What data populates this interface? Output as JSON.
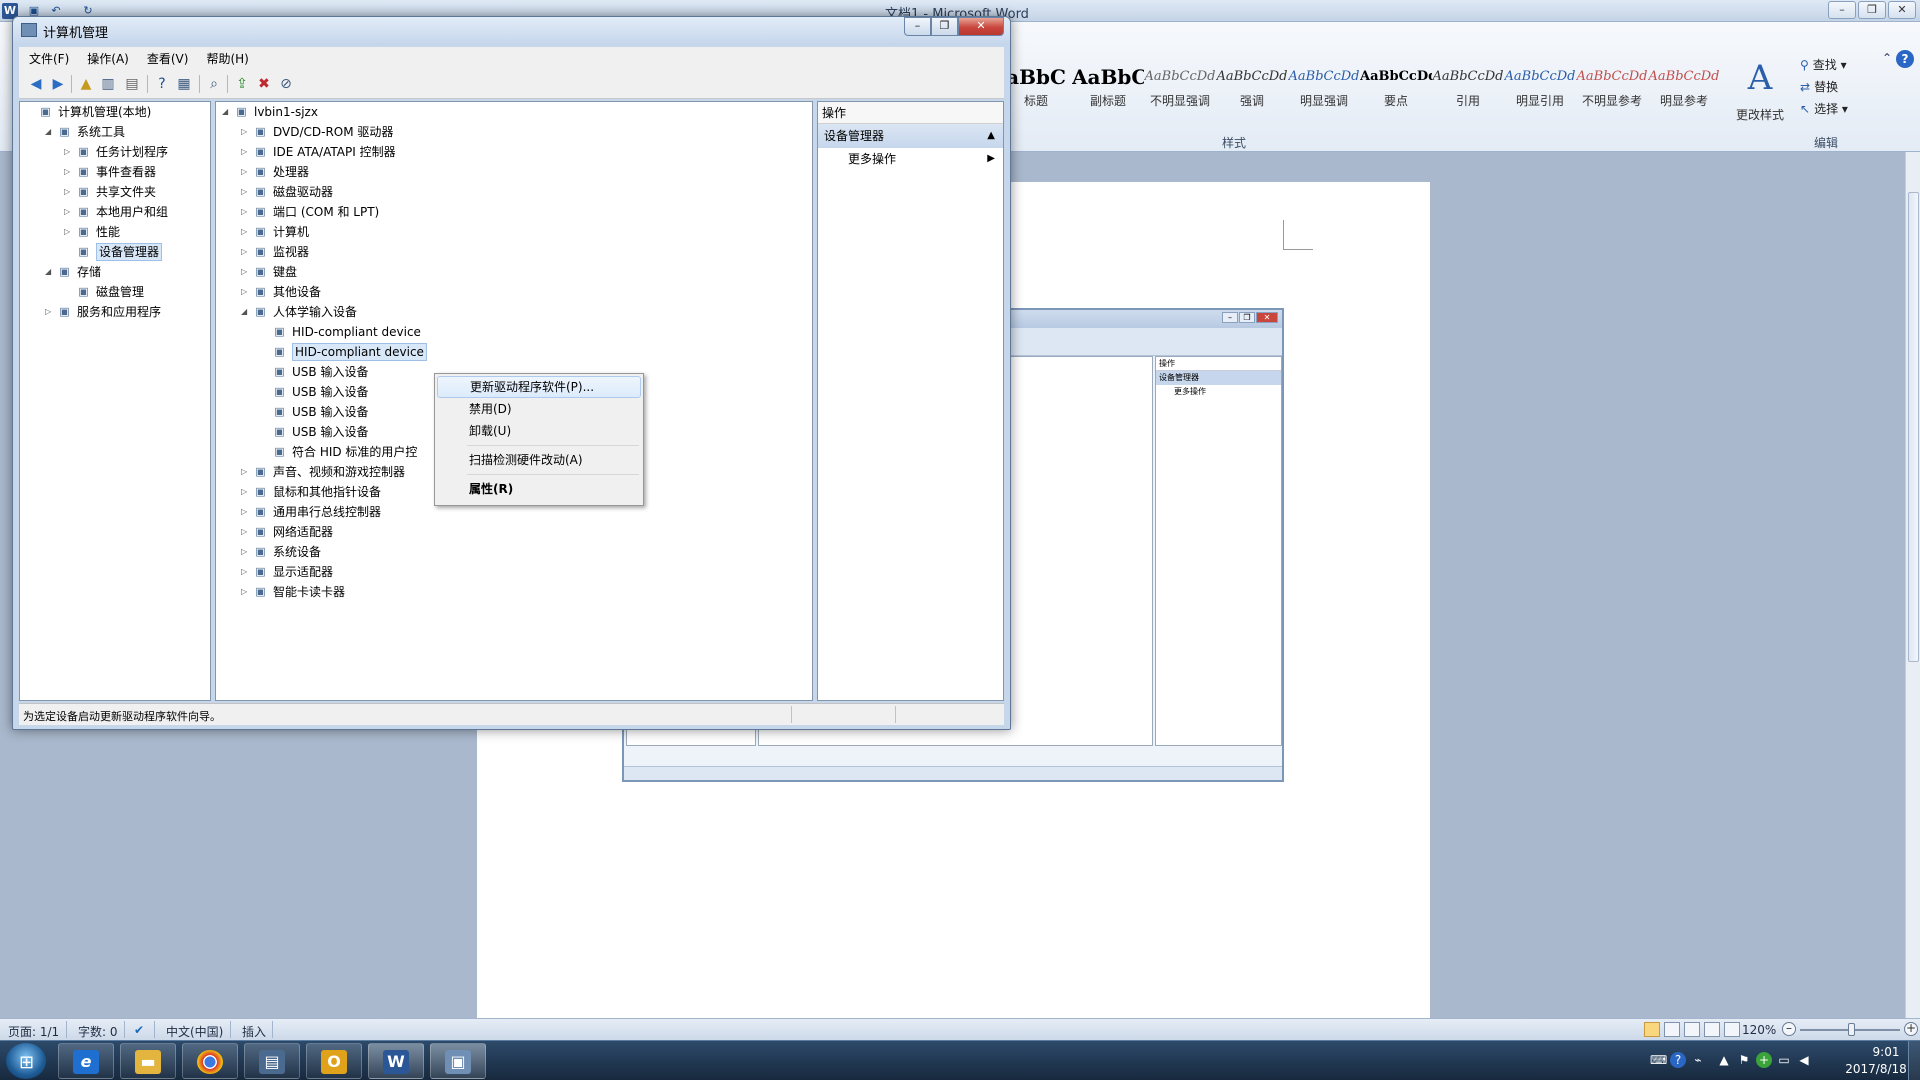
{
  "word": {
    "title": "文档1 - Microsoft Word",
    "styles": [
      {
        "sample": "aBbC",
        "label": "标题",
        "big": true
      },
      {
        "sample": "AaBbC",
        "label": "副标题",
        "big": true
      },
      {
        "sample": "AaBbCcDd",
        "label": "不明显强调"
      },
      {
        "sample": "AaBbCcDd",
        "label": "强调"
      },
      {
        "sample": "AaBbCcDd",
        "label": "明显强调"
      },
      {
        "sample": "AaBbCcDd",
        "label": "要点"
      },
      {
        "sample": "AaBbCcDd",
        "label": "引用"
      },
      {
        "sample": "AaBbCcDd",
        "label": "明显引用"
      },
      {
        "sample": "AaBbCcDd",
        "label": "不明显参考"
      },
      {
        "sample": "AaBbCcDd",
        "label": "明显参考"
      }
    ],
    "change_styles_label": "更改样式",
    "group_styles": "样式",
    "group_edit": "编辑",
    "edit_find": "查找",
    "edit_replace": "替换",
    "edit_select": "选择",
    "embed": {
      "ops_header": "操作",
      "ops_group": "设备管理器",
      "ops_more": "更多操作"
    },
    "status": {
      "page": "页面: 1/1",
      "words": "字数: 0",
      "lang": "中文(中国)",
      "mode": "插入",
      "zoom": "120%"
    }
  },
  "cm": {
    "title": "计算机管理",
    "menu": [
      "文件(F)",
      "操作(A)",
      "查看(V)",
      "帮助(H)"
    ],
    "left_tree": [
      {
        "label": "计算机管理(本地)",
        "level": 0,
        "twisty": "",
        "icon": "computer-icon"
      },
      {
        "label": "系统工具",
        "level": 1,
        "twisty": "◢",
        "icon": "tools-icon"
      },
      {
        "label": "任务计划程序",
        "level": 2,
        "twisty": "▷",
        "icon": "clock-icon"
      },
      {
        "label": "事件查看器",
        "level": 2,
        "twisty": "▷",
        "icon": "event-icon"
      },
      {
        "label": "共享文件夹",
        "level": 2,
        "twisty": "▷",
        "icon": "folder-icon"
      },
      {
        "label": "本地用户和组",
        "level": 2,
        "twisty": "▷",
        "icon": "users-icon"
      },
      {
        "label": "性能",
        "level": 2,
        "twisty": "▷",
        "icon": "performance-icon"
      },
      {
        "label": "设备管理器",
        "level": 2,
        "twisty": "",
        "icon": "device-manager-icon",
        "selected": true
      },
      {
        "label": "存储",
        "level": 1,
        "twisty": "◢",
        "icon": "storage-icon"
      },
      {
        "label": "磁盘管理",
        "level": 2,
        "twisty": "",
        "icon": "disk-icon"
      },
      {
        "label": "服务和应用程序",
        "level": 1,
        "twisty": "▷",
        "icon": "services-icon"
      }
    ],
    "device_tree": [
      {
        "label": "lvbin1-sjzx",
        "level": 0,
        "twisty": "◢",
        "icon": "computer-icon"
      },
      {
        "label": "DVD/CD-ROM 驱动器",
        "level": 1,
        "twisty": "▷",
        "icon": "cdrom-icon"
      },
      {
        "label": "IDE ATA/ATAPI 控制器",
        "level": 1,
        "twisty": "▷",
        "icon": "ide-icon"
      },
      {
        "label": "处理器",
        "level": 1,
        "twisty": "▷",
        "icon": "cpu-icon"
      },
      {
        "label": "磁盘驱动器",
        "level": 1,
        "twisty": "▷",
        "icon": "disk-icon"
      },
      {
        "label": "端口 (COM 和 LPT)",
        "level": 1,
        "twisty": "▷",
        "icon": "port-icon"
      },
      {
        "label": "计算机",
        "level": 1,
        "twisty": "▷",
        "icon": "computer-icon"
      },
      {
        "label": "监视器",
        "level": 1,
        "twisty": "▷",
        "icon": "monitor-icon"
      },
      {
        "label": "键盘",
        "level": 1,
        "twisty": "▷",
        "icon": "keyboard-icon"
      },
      {
        "label": "其他设备",
        "level": 1,
        "twisty": "▷",
        "icon": "other-device-icon"
      },
      {
        "label": "人体学输入设备",
        "level": 1,
        "twisty": "◢",
        "icon": "hid-icon"
      },
      {
        "label": "HID-compliant device",
        "level": 2,
        "twisty": "",
        "icon": "hid-icon"
      },
      {
        "label": "HID-compliant device",
        "level": 2,
        "twisty": "",
        "icon": "hid-icon",
        "selected": true
      },
      {
        "label": "USB 输入设备",
        "level": 2,
        "twisty": "",
        "icon": "hid-icon"
      },
      {
        "label": "USB 输入设备",
        "level": 2,
        "twisty": "",
        "icon": "hid-icon"
      },
      {
        "label": "USB 输入设备",
        "level": 2,
        "twisty": "",
        "icon": "hid-icon"
      },
      {
        "label": "USB 输入设备",
        "level": 2,
        "twisty": "",
        "icon": "hid-icon"
      },
      {
        "label": "符合 HID 标准的用户控",
        "level": 2,
        "twisty": "",
        "icon": "hid-icon"
      },
      {
        "label": "声音、视频和游戏控制器",
        "level": 1,
        "twisty": "▷",
        "icon": "sound-icon"
      },
      {
        "label": "鼠标和其他指针设备",
        "level": 1,
        "twisty": "▷",
        "icon": "mouse-icon"
      },
      {
        "label": "通用串行总线控制器",
        "level": 1,
        "twisty": "▷",
        "icon": "usb-icon"
      },
      {
        "label": "网络适配器",
        "level": 1,
        "twisty": "▷",
        "icon": "network-icon"
      },
      {
        "label": "系统设备",
        "level": 1,
        "twisty": "▷",
        "icon": "system-icon"
      },
      {
        "label": "显示适配器",
        "level": 1,
        "twisty": "▷",
        "icon": "display-icon"
      },
      {
        "label": "智能卡读卡器",
        "level": 1,
        "twisty": "▷",
        "icon": "smartcard-icon"
      }
    ],
    "ops_header": "操作",
    "ops_group": "设备管理器",
    "ops_more": "更多操作",
    "status": "为选定设备启动更新驱动程序软件向导。"
  },
  "context_menu": [
    {
      "label": "更新驱动程序软件(P)...",
      "hot": true
    },
    {
      "label": "禁用(D)"
    },
    {
      "label": "卸载(U)"
    },
    {
      "sep": true
    },
    {
      "label": "扫描检测硬件改动(A)"
    },
    {
      "sep": true
    },
    {
      "label": "属性(R)",
      "bold": true
    }
  ],
  "taskbar": {
    "time": "9:01",
    "date": "2017/8/18"
  },
  "colors": {
    "selection": "#d9e8f8",
    "title_gradient_top": "#e2ecf8",
    "close_button": "#c9463d",
    "taskbar": "#17293e"
  }
}
